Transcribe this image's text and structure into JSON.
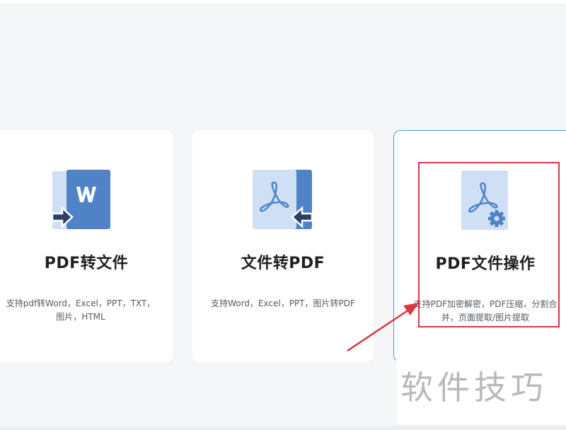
{
  "cards": [
    {
      "title": "PDF转文件",
      "desc_line1": "支持pdf转Word，Excel，PPT，TXT，",
      "desc_line2": "图片，HTML",
      "icon": "pdf-to-word-icon",
      "icon_letter": "W"
    },
    {
      "title": "文件转PDF",
      "desc_line1": "支持Word，Excel，PPT，图片转PDF",
      "icon": "file-to-pdf-icon"
    },
    {
      "title": "PDF文件操作",
      "desc_line1": "支持PDF加密解密，PDF压缩，分割合",
      "desc_line2": "并，页面提取/图片提取",
      "icon": "pdf-settings-icon"
    }
  ],
  "watermark": "软件技巧",
  "colors": {
    "page_bg": "#f5f6f8",
    "card_bg": "#ffffff",
    "icon_dark": "#4f83c6",
    "icon_light": "#cfe0f5",
    "active_border": "#4a9bd1",
    "annotation_red": "#d9363e"
  }
}
